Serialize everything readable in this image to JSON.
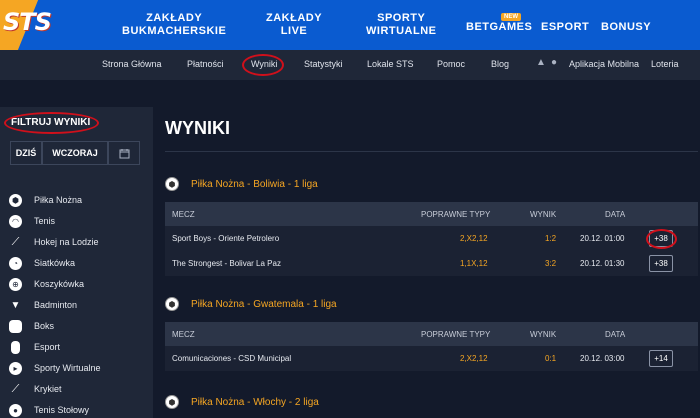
{
  "brand": {
    "logo_text": "STS"
  },
  "top_nav": [
    {
      "line1": "ZAKŁADY",
      "line2": "BUKMACHERSKIE"
    },
    {
      "line1": "ZAKŁADY",
      "line2": "LIVE"
    },
    {
      "line1": "SPORTY",
      "line2": "WIRTUALNE"
    },
    {
      "line1": "BETGAMES",
      "line2": "",
      "badge": "NEW"
    },
    {
      "line1": "ESPORT",
      "line2": ""
    },
    {
      "line1": "BONUSY",
      "line2": ""
    }
  ],
  "sub_nav": [
    "Strona Główna",
    "Płatności",
    "Wyniki",
    "Statystyki",
    "Lokale STS",
    "Pomoc",
    "Blog",
    "Aplikacja Mobilna",
    "Loteria"
  ],
  "sidebar": {
    "title": "FILTRUJ WYNIKI",
    "date_buttons": [
      "DZIŚ",
      "WCZORAJ"
    ],
    "sports": [
      "Piłka Nożna",
      "Tenis",
      "Hokej na Lodzie",
      "Siatkówka",
      "Koszykówka",
      "Badminton",
      "Boks",
      "Esport",
      "Sporty Wirtualne",
      "Krykiet",
      "Tenis Stołowy"
    ]
  },
  "main": {
    "title": "WYNIKI",
    "columns": {
      "match": "MECZ",
      "types": "POPRAWNE TYPY",
      "result": "WYNIK",
      "date": "DATA"
    },
    "leagues": [
      {
        "name": "Piłka Nożna - Boliwia - 1 liga",
        "rows": [
          {
            "match": "Sport Boys - Oriente Petrolero",
            "types": "2,X2,12",
            "result": "1:2",
            "date": "20.12. 01:00",
            "more": "+38"
          },
          {
            "match": "The Strongest - Bolivar La Paz",
            "types": "1,1X,12",
            "result": "3:2",
            "date": "20.12. 01:30",
            "more": "+38"
          }
        ]
      },
      {
        "name": "Piłka Nożna - Gwatemala - 1 liga",
        "rows": [
          {
            "match": "Comunicaciones - CSD Municipal",
            "types": "2,X2,12",
            "result": "0:1",
            "date": "20.12. 03:00",
            "more": "+14"
          }
        ]
      },
      {
        "name": "Piłka Nożna - Włochy - 2 liga",
        "rows": []
      }
    ]
  },
  "colors": {
    "brand_blue": "#0a5bd0",
    "accent_orange": "#f5a623",
    "annotation_red": "#d0101b"
  }
}
